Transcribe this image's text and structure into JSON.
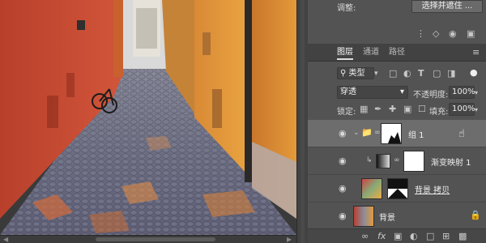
{
  "top": {
    "adjust_label": "调整:",
    "select_mask_button": "选择并遮住 ..."
  },
  "tabs": [
    {
      "label": "图层"
    },
    {
      "label": "通道"
    },
    {
      "label": "路径"
    }
  ],
  "filter": {
    "type_label": "类型",
    "dropdown_caret": "▾"
  },
  "blend": {
    "mode": "穿透",
    "opacity_label": "不透明度:",
    "opacity_value": "100%",
    "lock_label": "锁定:",
    "fill_label": "填充:",
    "fill_value": "100%"
  },
  "layers": [
    {
      "name": "组 1",
      "kind": "group"
    },
    {
      "name": "渐变映射 1",
      "kind": "adjustment"
    },
    {
      "name": "背景 拷贝",
      "kind": "image"
    },
    {
      "name": "背景",
      "kind": "background"
    }
  ],
  "bottom_icons": [
    "link-icon",
    "fx-icon",
    "mask-icon",
    "adjustment-icon",
    "folder-icon",
    "new-layer-icon",
    "delete-icon"
  ],
  "colors": {
    "panel": "#535353",
    "selected_layer": "#6d6d6d",
    "wall_left": "#c9452e",
    "wall_right": "#e39a3d"
  }
}
